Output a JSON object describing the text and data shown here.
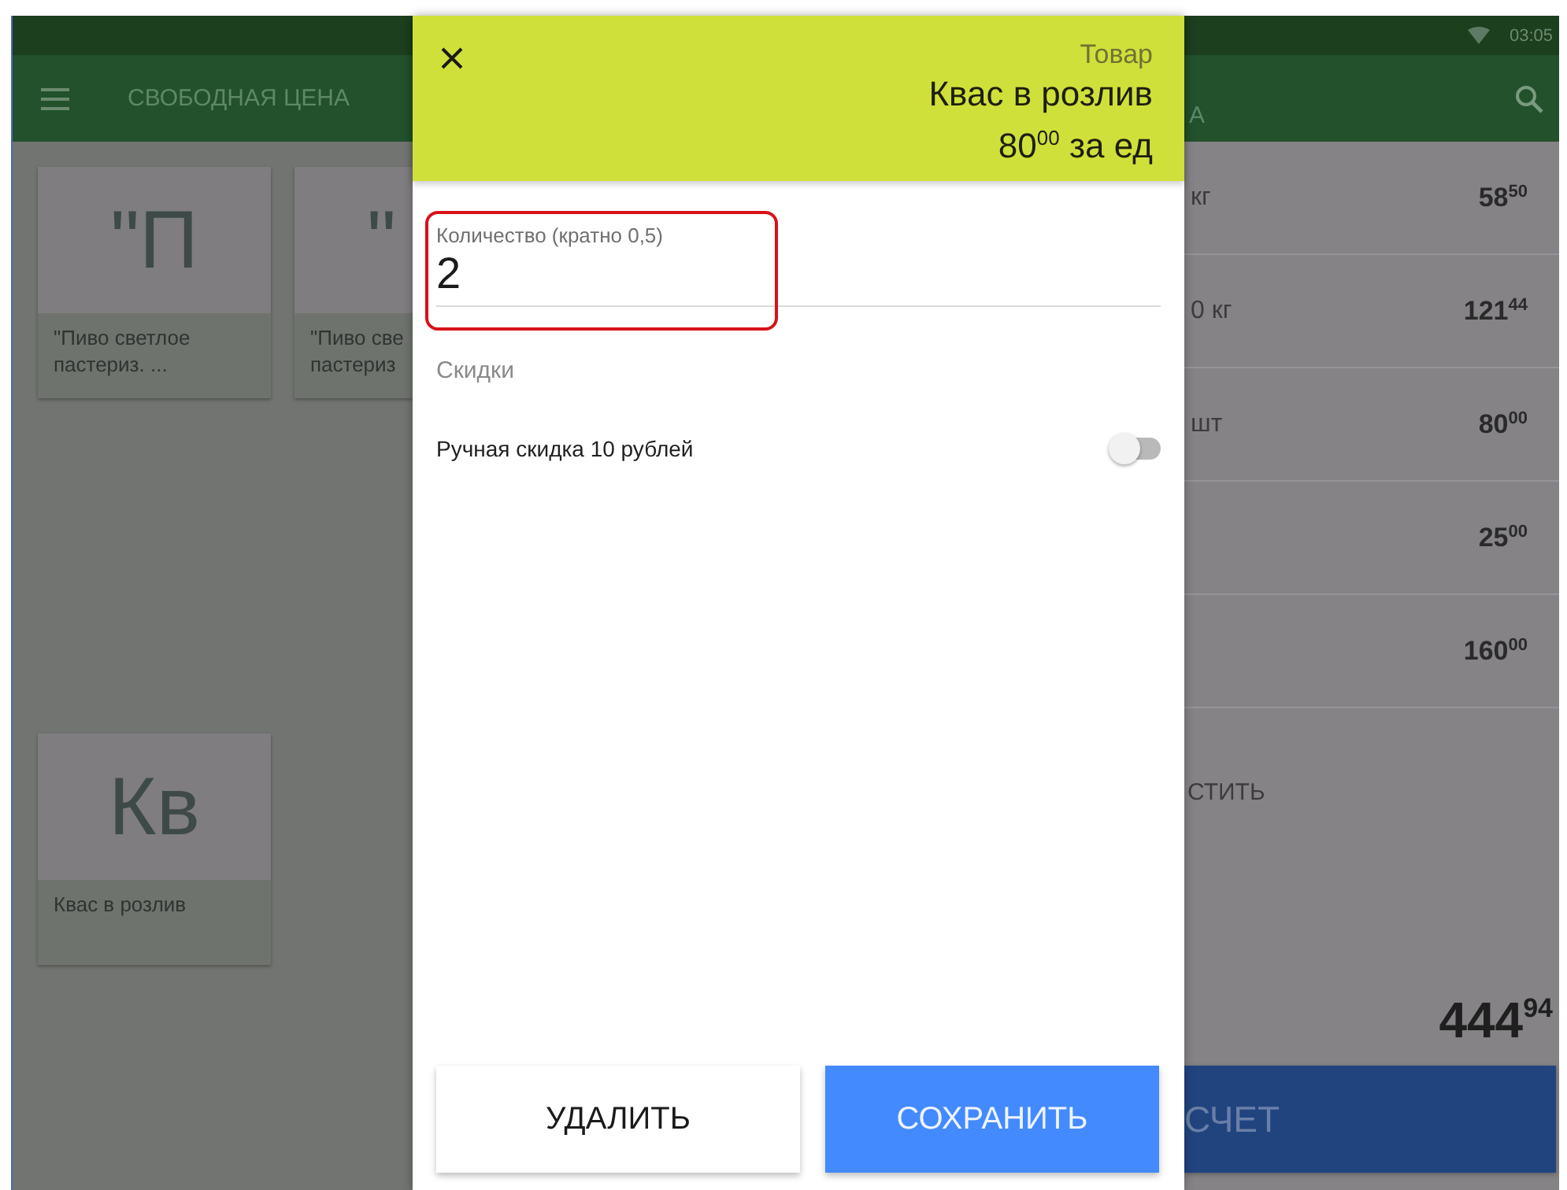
{
  "status_bar": {
    "time": "03:05"
  },
  "toolbar": {
    "title": "СВОБОДНАЯ ЦЕНА",
    "title_tail": "А"
  },
  "tiles": [
    {
      "initials": "\"П",
      "name_lines": [
        "\"Пиво светлое",
        "пастериз. ..."
      ]
    },
    {
      "initials": "\"",
      "name_lines": [
        "\"Пиво све",
        "пастериз"
      ]
    },
    {
      "initials": "Кв",
      "name_lines": [
        "Квас в розлив"
      ]
    }
  ],
  "cart": {
    "rows": [
      {
        "name": "кг",
        "price": "58$^{50}$"
      },
      {
        "name": "0 кг",
        "price": "121$^{44}$"
      },
      {
        "name": "шт",
        "price": "80$^{00}$"
      },
      {
        "price": "25$^{00}$"
      },
      {
        "price": "160$^{00}$"
      }
    ],
    "clear_label": "СТИТЬ",
    "total": "444$^{94}$",
    "checkout_button": "СЧЕТ"
  },
  "dialog": {
    "caption": "Товар",
    "product": "Квас в розлив",
    "price": "80$^{00}$ за ед",
    "quantity": {
      "label": "Количество (кратно 0,5)",
      "value": "2",
      "highlighted": true
    },
    "discounts_heading": "Скидки",
    "discounts": [
      {
        "label": "Ручная скидка 10 рублей",
        "on": false
      }
    ],
    "buttons": [
      {
        "label": "УДАЛИТЬ",
        "kind": "secondary"
      },
      {
        "label": "СОХРАНИТЬ",
        "kind": "primary"
      }
    ]
  }
}
